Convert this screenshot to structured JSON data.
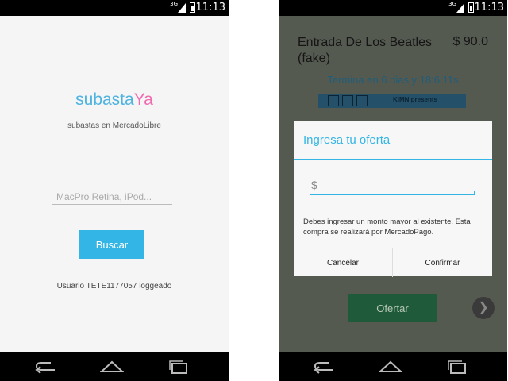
{
  "status_bar": {
    "time": "11:13",
    "network": "3G"
  },
  "search_screen": {
    "logo_part1": "subasta",
    "logo_part2": "Ya",
    "subtitle": "subastas en MercadoLibre",
    "search_placeholder": "MacPro Retina, iPod...",
    "search_button": "Buscar",
    "user_status": "Usuario TETE1177057 loggeado"
  },
  "item_screen": {
    "title": "Entrada De Los Beatles (fake)",
    "price": "$ 90.0",
    "ends_in": "Termina en 6 dias y 18:6:11s",
    "ticket_text": "KIMN presents",
    "offer_button": "Ofertar",
    "next_icon": "chevron-right-icon"
  },
  "bid_dialog": {
    "title": "Ingresa tu oferta",
    "currency_symbol": "$",
    "amount_value": "",
    "message": "Debes ingresar un monto mayor al existente. Esta compra se realizará por MercadoPago.",
    "cancel_label": "Cancelar",
    "confirm_label": "Confirmar"
  },
  "colors": {
    "accent": "#33b5e5",
    "logo_pink": "#f06bb0",
    "offer_green": "#1f5b3a"
  }
}
